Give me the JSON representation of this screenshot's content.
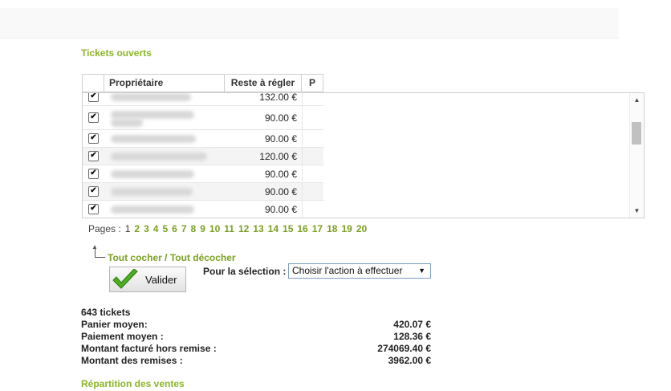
{
  "section": {
    "tickets_title": "Tickets ouverts",
    "repartition_title": "Répartition des ventes"
  },
  "table": {
    "columns": [
      "Propriétaire",
      "Reste à régler",
      "P"
    ],
    "rows": [
      {
        "checked": true,
        "amount": "132.00 €"
      },
      {
        "checked": true,
        "amount": "90.00 €"
      },
      {
        "checked": true,
        "amount": "90.00 €"
      },
      {
        "checked": true,
        "amount": "120.00 €"
      },
      {
        "checked": true,
        "amount": "90.00 €"
      },
      {
        "checked": true,
        "amount": "90.00 €"
      },
      {
        "checked": true,
        "amount": "90.00 €"
      }
    ]
  },
  "pager": {
    "label": "Pages :",
    "current": "1",
    "pages": [
      "2",
      "3",
      "4",
      "5",
      "6",
      "7",
      "8",
      "9",
      "10",
      "11",
      "12",
      "13",
      "14",
      "15",
      "16",
      "17",
      "18",
      "19",
      "20"
    ]
  },
  "selection": {
    "check_all": "Tout cocher",
    "separator": "/",
    "uncheck_all": "Tout décocher",
    "label": "Pour la sélection :",
    "select_value": "Choisir l'action à effectuer",
    "validate_label": "Valider"
  },
  "stats": {
    "count": "643 tickets",
    "items": [
      {
        "label": "Panier moyen:",
        "value": "420.07  €"
      },
      {
        "label": "Paiement moyen :",
        "value": "128.36  €"
      },
      {
        "label": "Montant facturé hors remise :",
        "value": "274069.40  €"
      },
      {
        "label": "Montant des remises :",
        "value": "3962.00  €"
      }
    ]
  },
  "colors": {
    "accent": "#8cb527",
    "link": "#7aa021"
  },
  "icons": {
    "validate": "green-checkmark-icon",
    "select_caret": "caret-down-icon",
    "scroll_up": "scroll-up-icon",
    "scroll_down": "scroll-down-icon"
  }
}
